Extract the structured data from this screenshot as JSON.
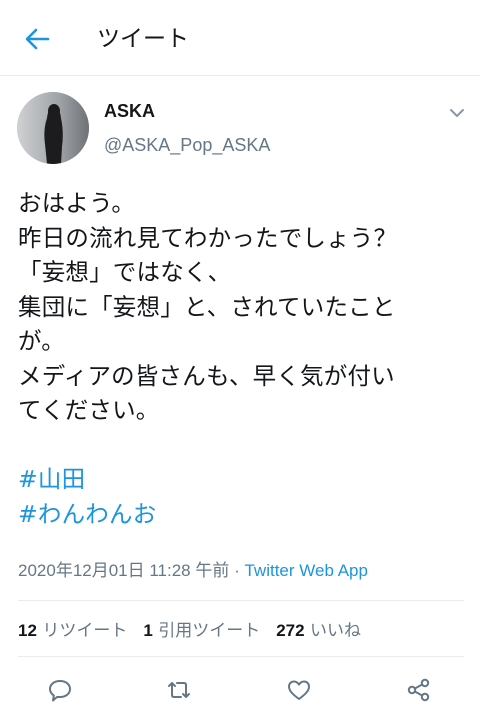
{
  "header": {
    "title": "ツイート"
  },
  "author": {
    "name": "ASKA",
    "handle": "@ASKA_Pop_ASKA"
  },
  "tweet": {
    "lines": [
      "おはよう。",
      "昨日の流れ見てわかったでしょう？",
      "「妄想」ではなく、",
      "集団に「妄想」と、されていたこと",
      "が。",
      "メディアの皆さんも、早く気が付い",
      "てください。"
    ],
    "hashtags": [
      "#山田",
      "#わんわんお"
    ]
  },
  "meta": {
    "timestamp": "2020年12月01日 11:28 午前",
    "separator": " · ",
    "source": "Twitter Web App"
  },
  "stats": {
    "retweets": {
      "count": "12",
      "label": "リツイート"
    },
    "quotes": {
      "count": "1",
      "label": "引用ツイート"
    },
    "likes": {
      "count": "272",
      "label": "いいね"
    }
  },
  "colors": {
    "accent": "#1b95e0",
    "secondary_text": "#657786",
    "divider": "#e6ecf0"
  },
  "icons": [
    "back-arrow-icon",
    "caret-down-icon",
    "reply-icon",
    "retweet-icon",
    "like-icon",
    "share-icon"
  ]
}
